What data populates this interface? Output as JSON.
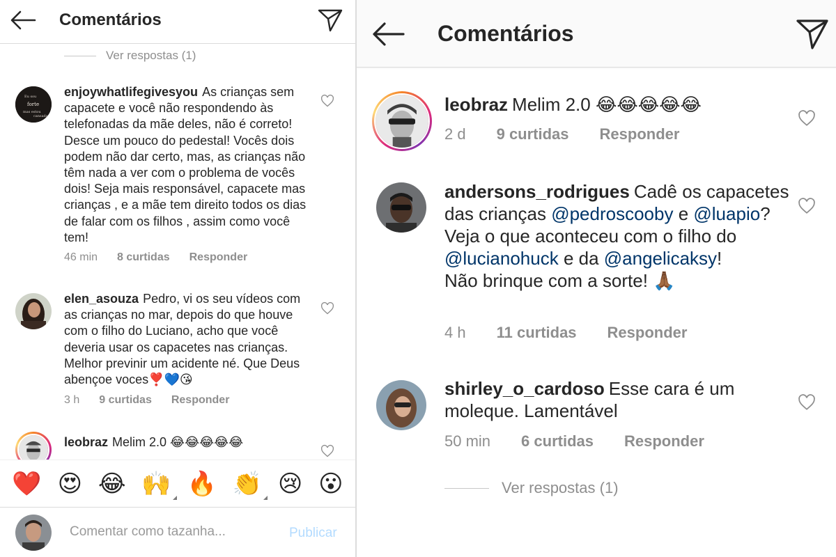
{
  "left": {
    "header": {
      "title": "Comentários"
    },
    "view_replies": "Ver respostas (1)",
    "comments": [
      {
        "username": "enjoywhatlifegivesyou",
        "text": "As crianças sem capacete e você não respondendo às telefonadas da mãe deles, não é correto! Desce um pouco do pedestal! Vocês dois podem não dar certo, mas, as crianças não têm nada a ver com o problema de vocês dois! Seja mais responsável, capacete mas crianças , e a mãe tem direito todos os dias de falar com os filhos , assim como você tem!",
        "time": "46 min",
        "likes": "8 curtidas",
        "reply": "Responder",
        "avatar_text": [
          "Eu sou",
          "forte",
          "mas estou",
          "cansada"
        ]
      },
      {
        "username": "elen_asouza",
        "text": "Pedro, vi os seu vídeos com as crianças no mar, depois do que houve com o filho do Luciano, acho que você deveria usar os capacetes nas crianças. Melhor previnir um acidente né. Que Deus abençoe voces❣️💙😘",
        "time": "3 h",
        "likes": "9 curtidas",
        "reply": "Responder"
      },
      {
        "username": "leobraz",
        "text": "Melim 2.0 😂😂😂😂😂"
      }
    ],
    "emoji_bar": [
      "❤️",
      "😍",
      "😂",
      "🙌",
      "🔥",
      "👏",
      "😢",
      "😮"
    ],
    "composer": {
      "placeholder": "Comentar como tazanha...",
      "publish": "Publicar"
    }
  },
  "right": {
    "header": {
      "title": "Comentários"
    },
    "comments": [
      {
        "username": "leobraz",
        "text": "Melim 2.0 😂😂😂😂😂",
        "time": "2 d",
        "likes": "9 curtidas",
        "reply": "Responder"
      },
      {
        "username": "andersons_rodrigues",
        "text_parts": [
          "Cadê os capacetes das crianças ",
          "@pedroscooby",
          " e ",
          "@luapio",
          "?",
          "Veja o que aconteceu com o filho do ",
          "@lucianohuck",
          " e da ",
          "@angelicaksy",
          "!",
          "Não brinque com a sorte! 🙏🏾"
        ],
        "time": "4 h",
        "likes": "11 curtidas",
        "reply": "Responder"
      },
      {
        "username": "shirley_o_cardoso",
        "text": "Esse cara é um moleque. Lamentável",
        "time": "50 min",
        "likes": "6 curtidas",
        "reply": "Responder"
      }
    ],
    "view_replies": "Ver respostas (1)"
  },
  "colors": {
    "text": "#262626",
    "meta": "#8e8e8e",
    "mention": "#003569",
    "publish_disabled": "#b3dbff",
    "divider": "#dbdbdb"
  },
  "icons": {
    "back": "back-arrow-icon",
    "send": "direct-send-icon",
    "like": "heart-outline-icon"
  }
}
